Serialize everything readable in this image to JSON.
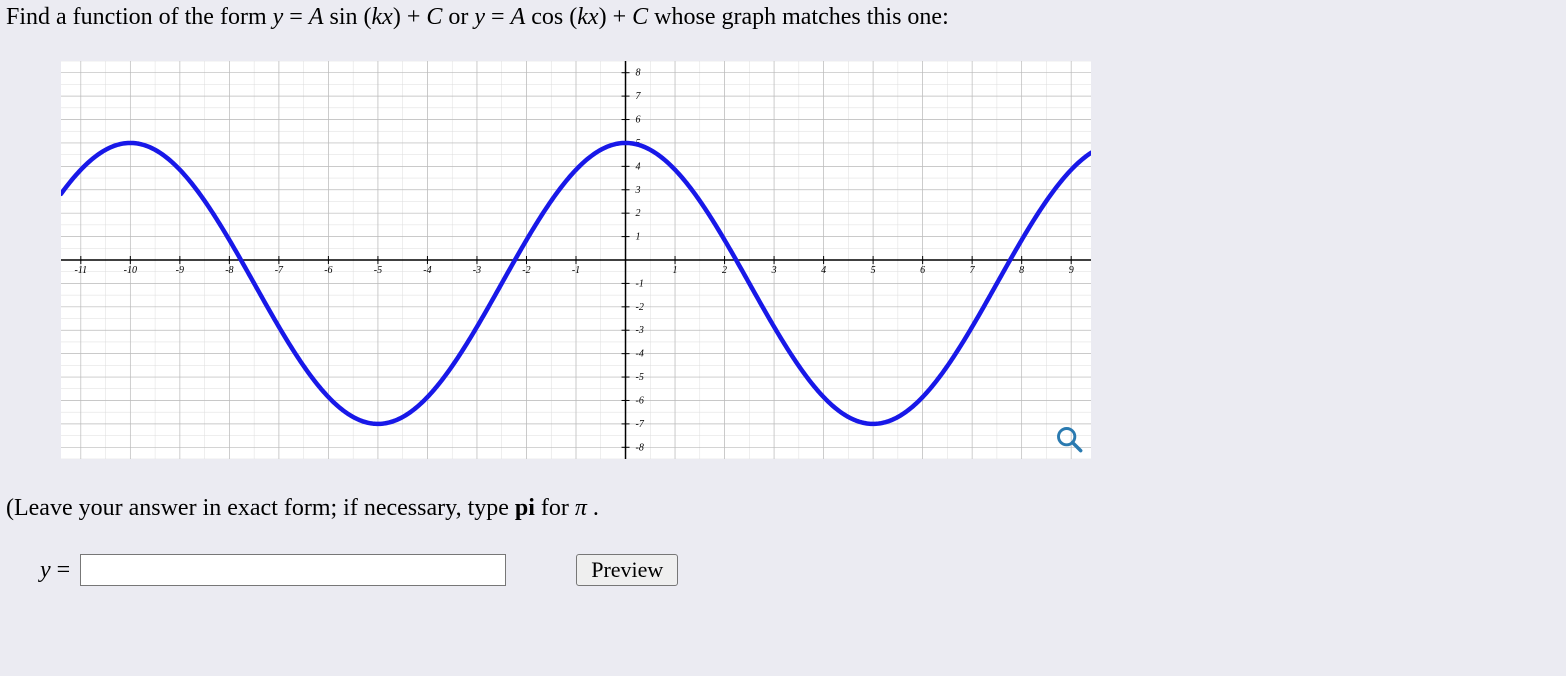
{
  "prompt": {
    "prefix": "Find a function of the form  ",
    "y": "y",
    "eq": " = ",
    "form1_A": "A",
    "form1_func": " sin",
    "form1_arg": "(kx)",
    "plusC": " + C",
    "or": " or  ",
    "form2_func": " cos",
    "suffix": " whose graph matches this one:"
  },
  "instr": {
    "prefix": "(Leave your answer in exact form; if necessary, type ",
    "pi_bold": "pi",
    "mid": " for ",
    "pi_sym": "π",
    "period": "."
  },
  "answer": {
    "label_y": "y",
    "label_eq": " = ",
    "value": "",
    "preview": "Preview"
  },
  "chart_data": {
    "type": "line",
    "xlim": [
      -11.4,
      9.4
    ],
    "ylim": [
      -8.5,
      8.5
    ],
    "xticks": [
      -11,
      -10,
      -9,
      -8,
      -7,
      -6,
      -5,
      -4,
      -3,
      -2,
      -1,
      1,
      2,
      3,
      4,
      5,
      6,
      7,
      8,
      9
    ],
    "yticks": [
      -8,
      -7,
      -6,
      -5,
      -4,
      -3,
      -2,
      -1,
      1,
      2,
      3,
      4,
      5,
      6,
      7,
      8
    ],
    "function": "6*cos(pi/5*x) - 1",
    "amplitude": 6,
    "vertical_shift": -1,
    "angular_freq_over_pi": 0.2,
    "period": 10,
    "max_value": 5,
    "min_value": -7,
    "x_start": -11.4,
    "x_end": 9.4
  }
}
